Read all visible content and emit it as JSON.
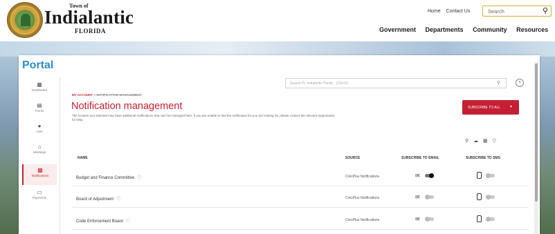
{
  "header": {
    "town_of": "Town of",
    "town_name": "Indialantic",
    "state": "FLORIDA",
    "top_links": [
      "Home",
      "Contact Us"
    ],
    "search_placeholder": "Search",
    "nav": [
      "Government",
      "Departments",
      "Community",
      "Resources"
    ]
  },
  "portal": {
    "title": "Portal",
    "search_placeholder": "Search FL Indialantic Portal... (Ctrl+K)",
    "sidebar": [
      {
        "label": "Dashboard",
        "icon": "dashboard-icon",
        "glyph": "▦"
      },
      {
        "label": "Forms",
        "icon": "forms-icon",
        "glyph": "▤"
      },
      {
        "label": "Lists",
        "icon": "lists-icon",
        "glyph": "●"
      },
      {
        "label": "Meetings",
        "icon": "meetings-icon",
        "glyph": "⌂"
      },
      {
        "label": "Notifications",
        "icon": "notifications-icon",
        "glyph": "▩"
      },
      {
        "label": "Payments",
        "icon": "payments-icon",
        "glyph": "▭"
      }
    ],
    "active_item": "Notifications",
    "breadcrumb_root": "MY ACCOUNT",
    "breadcrumb_sep": ">",
    "breadcrumb_current": "NOTIFICATION MANAGEMENT",
    "page_title": "Notification management",
    "description": "The location you selected may have additional notifications that can't be managed here. If you are unable to find the notification list you are looking for, please contact the relevant organization for help.",
    "action_button": "SUBSCRIBE TO ALL",
    "table": {
      "headers": [
        "NAME",
        "SOURCE",
        "SUBSCRIBE TO EMAIL",
        "SUBSCRIBE TO SMS"
      ],
      "rows": [
        {
          "name": "Budget and Finance Committee",
          "source": "CivicPlus Notifications",
          "email": true,
          "sms": false
        },
        {
          "name": "Board of Adjustment",
          "source": "CivicPlus Notifications",
          "email": false,
          "sms": false
        },
        {
          "name": "Code Enforcement Board",
          "source": "CivicPlus Notifications",
          "email": false,
          "sms": false
        }
      ]
    }
  },
  "colors": {
    "accent": "#c51f33",
    "portal_title": "#2c8fd0",
    "search_border": "#d6ad2e"
  }
}
